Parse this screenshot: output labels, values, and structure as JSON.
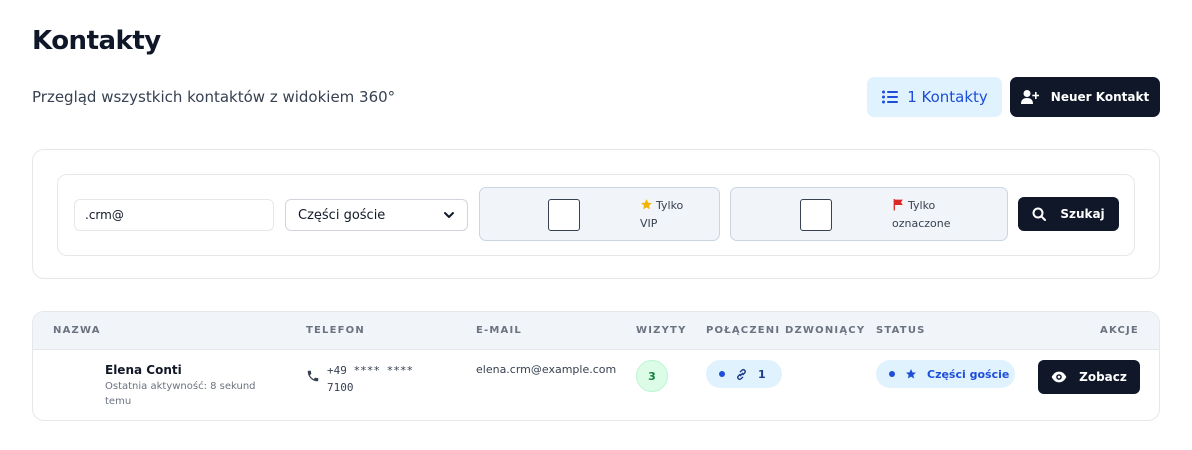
{
  "header": {
    "title": "Kontakty",
    "subtitle": "Przegląd wszystkich kontaktów z widokiem 360°",
    "count_label": "1 Kontakty",
    "new_contact_label": "Neuer Kontakt"
  },
  "filters": {
    "search_value": ".crm@",
    "status_selected": "Części goście",
    "vip_label_line1": "Tylko",
    "vip_label_line2": "VIP",
    "flag_label_line1": "Tylko",
    "flag_label_line2": "oznaczone",
    "search_button": "Szukaj"
  },
  "table": {
    "headers": [
      "NAZWA",
      "TELEFON",
      "E-MAIL",
      "WIZYTY",
      "POŁĄCZENI DZWONIĄCY",
      "STATUS",
      "AKCJE"
    ],
    "rows": [
      {
        "name": "Elena Conti",
        "last_activity": "Ostatnia aktywność: 8 sekund temu",
        "phone": "+49 **** **** 7100",
        "email": "elena.crm@example.com",
        "visits": "3",
        "callers": "1",
        "status": "Części goście",
        "action": "Zobacz"
      }
    ]
  },
  "colors": {
    "primary_dark": "#0f1729",
    "accent_blue": "#1d4ed8",
    "chip_bg": "#e0f2fe",
    "visits_green": "#15803d",
    "vip_star": "#f5b301",
    "flag_red": "#dc2626"
  },
  "icons": {
    "count": "list-icon",
    "new_contact": "user-plus-icon",
    "vip": "star-icon",
    "flag": "flag-icon",
    "search": "search-icon",
    "phone": "phone-icon",
    "callers": "link-icon",
    "status": "star-icon",
    "view": "eye-icon"
  }
}
